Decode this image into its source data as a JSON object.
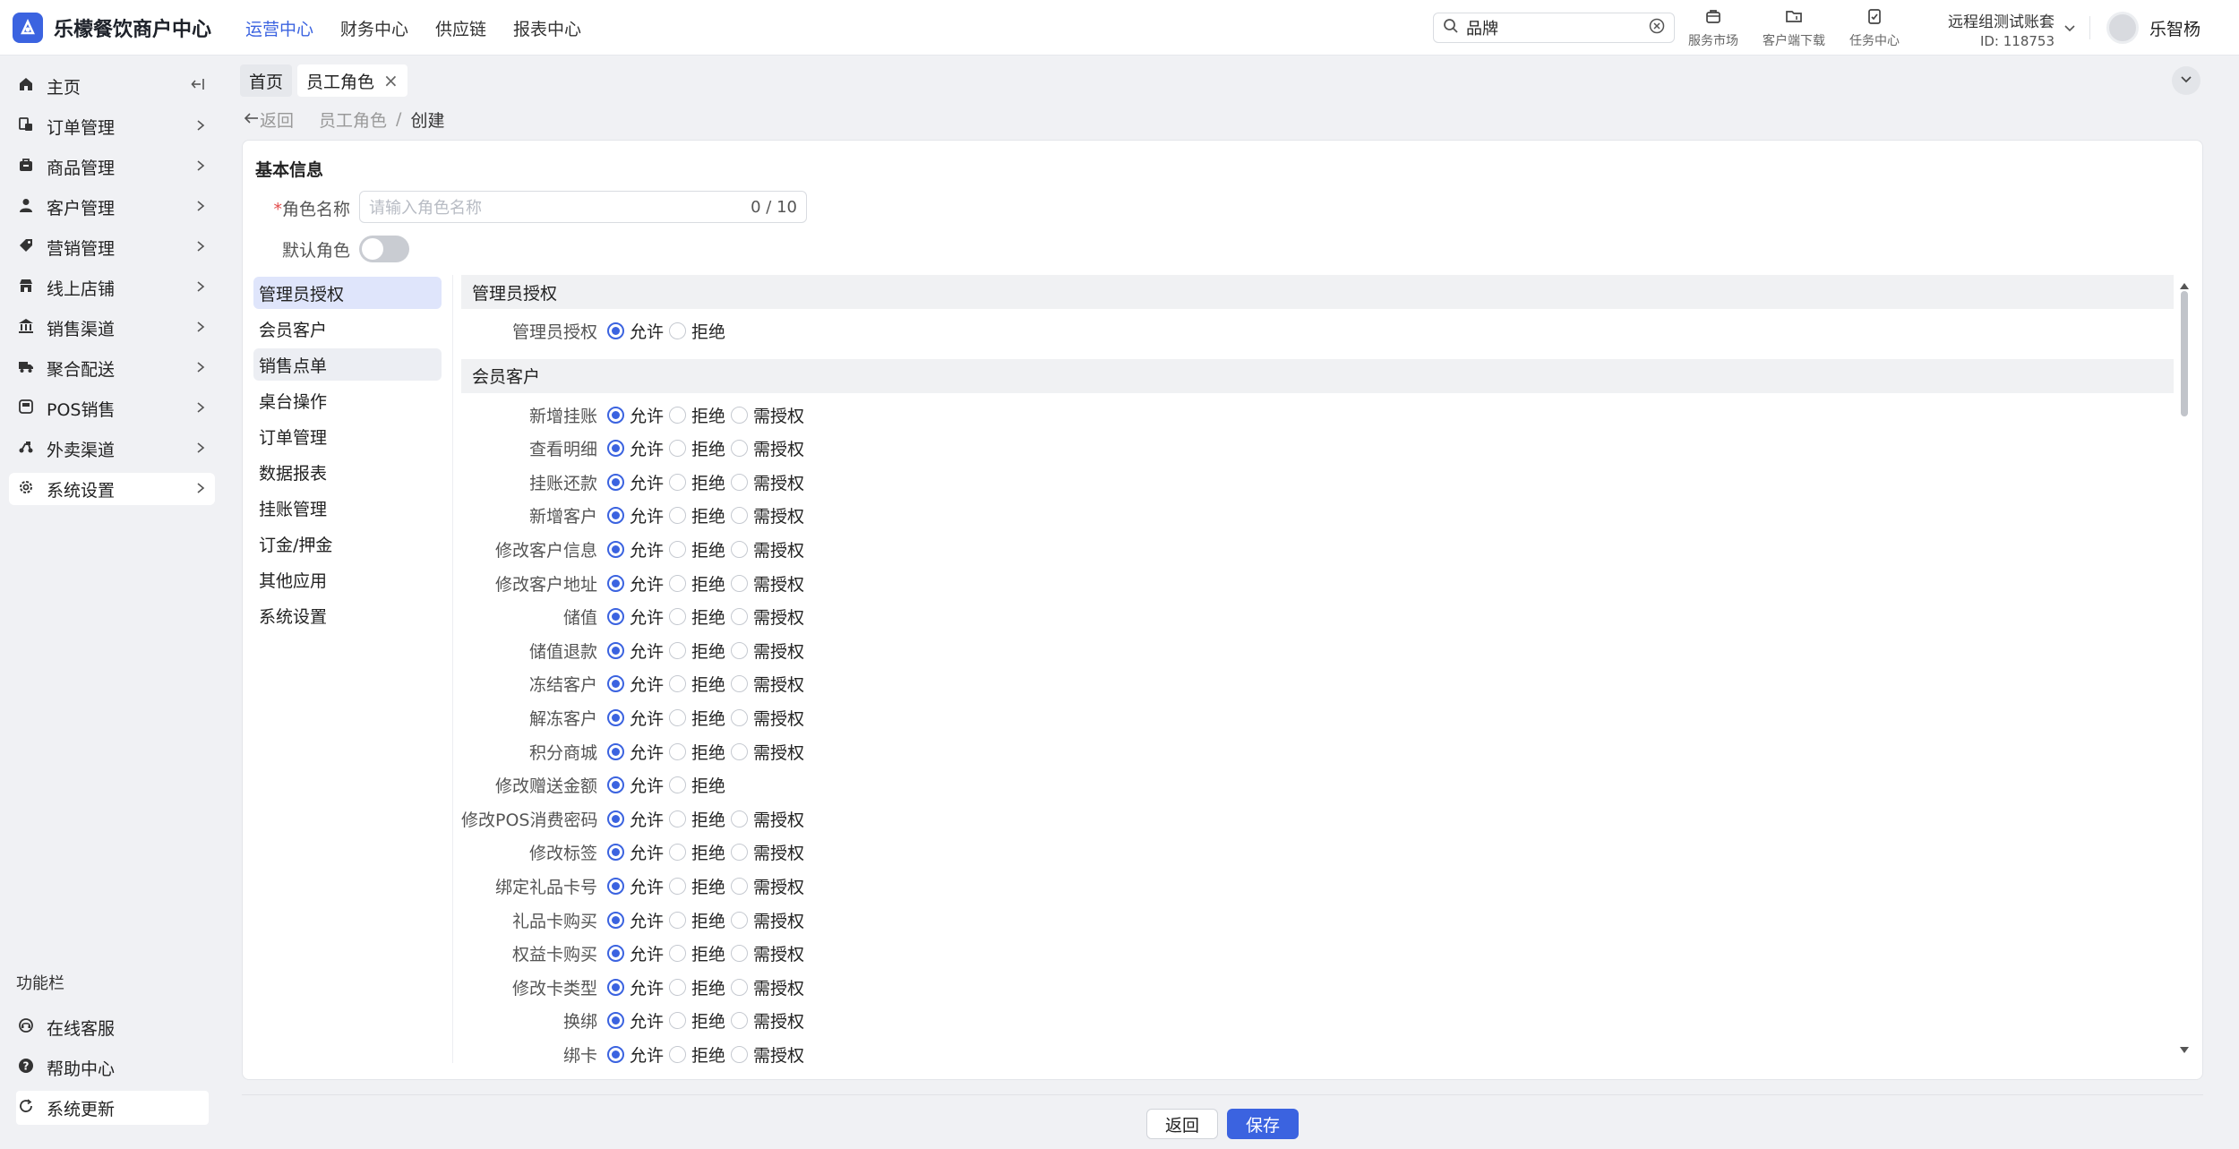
{
  "app": {
    "title": "乐檬餐饮商户中心"
  },
  "topnav": [
    {
      "label": "运营中心",
      "active": true
    },
    {
      "label": "财务中心",
      "active": false
    },
    {
      "label": "供应链",
      "active": false
    },
    {
      "label": "报表中心",
      "active": false
    }
  ],
  "search": {
    "value": "品牌"
  },
  "tools": [
    {
      "label": "服务市场",
      "icon": "shop-icon"
    },
    {
      "label": "客户端下载",
      "icon": "folder-download-icon"
    },
    {
      "label": "任务中心",
      "icon": "clipboard-check-icon"
    }
  ],
  "account": {
    "name": "远程组测试账套",
    "id": "ID: 118753"
  },
  "user": {
    "name": "乐智杨"
  },
  "sidebar": {
    "items": [
      {
        "label": "主页",
        "icon": "home-icon"
      },
      {
        "label": "订单管理",
        "icon": "order-icon"
      },
      {
        "label": "商品管理",
        "icon": "goods-icon"
      },
      {
        "label": "客户管理",
        "icon": "user-icon"
      },
      {
        "label": "营销管理",
        "icon": "tag-icon"
      },
      {
        "label": "线上店铺",
        "icon": "store-icon"
      },
      {
        "label": "销售渠道",
        "icon": "bank-icon"
      },
      {
        "label": "聚合配送",
        "icon": "truck-icon"
      },
      {
        "label": "POS销售",
        "icon": "pos-icon"
      },
      {
        "label": "外卖渠道",
        "icon": "delivery-icon"
      },
      {
        "label": "系统设置",
        "icon": "gear-icon"
      }
    ],
    "func_title": "功能栏",
    "footer": [
      {
        "label": "在线客服",
        "icon": "chat-icon"
      },
      {
        "label": "帮助中心",
        "icon": "help-icon"
      },
      {
        "label": "系统更新",
        "icon": "refresh-icon"
      }
    ]
  },
  "tabs": {
    "home": "首页",
    "current": "员工角色"
  },
  "breadcrumb": {
    "back": "返回",
    "parent": "员工角色",
    "sep": "/",
    "current": "创建"
  },
  "form": {
    "section": "基本信息",
    "name_label": "角色名称",
    "name_placeholder": "请输入角色名称",
    "name_count": "0 / 10",
    "default_label": "默认角色"
  },
  "categories": [
    "管理员授权",
    "会员客户",
    "销售点单",
    "桌台操作",
    "订单管理",
    "数据报表",
    "挂账管理",
    "订金/押金",
    "其他应用",
    "系统设置"
  ],
  "options": {
    "allow": "允许",
    "deny": "拒绝",
    "need": "需授权"
  },
  "groups": [
    {
      "title": "管理员授权",
      "rows": [
        {
          "label": "管理员授权",
          "three": false
        }
      ]
    },
    {
      "title": "会员客户",
      "rows": [
        {
          "label": "新增挂账",
          "three": true
        },
        {
          "label": "查看明细",
          "three": true
        },
        {
          "label": "挂账还款",
          "three": true
        },
        {
          "label": "新增客户",
          "three": true
        },
        {
          "label": "修改客户信息",
          "three": true
        },
        {
          "label": "修改客户地址",
          "three": true
        },
        {
          "label": "储值",
          "three": true
        },
        {
          "label": "储值退款",
          "three": true
        },
        {
          "label": "冻结客户",
          "three": true
        },
        {
          "label": "解冻客户",
          "three": true
        },
        {
          "label": "积分商城",
          "three": true
        },
        {
          "label": "修改赠送金额",
          "three": false
        },
        {
          "label": "修改POS消费密码",
          "three": true
        },
        {
          "label": "修改标签",
          "three": true
        },
        {
          "label": "绑定礼品卡号",
          "three": true
        },
        {
          "label": "礼品卡购买",
          "three": true
        },
        {
          "label": "权益卡购买",
          "three": true
        },
        {
          "label": "修改卡类型",
          "three": true
        },
        {
          "label": "换绑",
          "three": true
        },
        {
          "label": "绑卡",
          "three": true
        }
      ]
    }
  ],
  "buttons": {
    "back": "返回",
    "save": "保存"
  },
  "colors": {
    "accent": "#3b63e0",
    "required": "#e34d4d"
  }
}
